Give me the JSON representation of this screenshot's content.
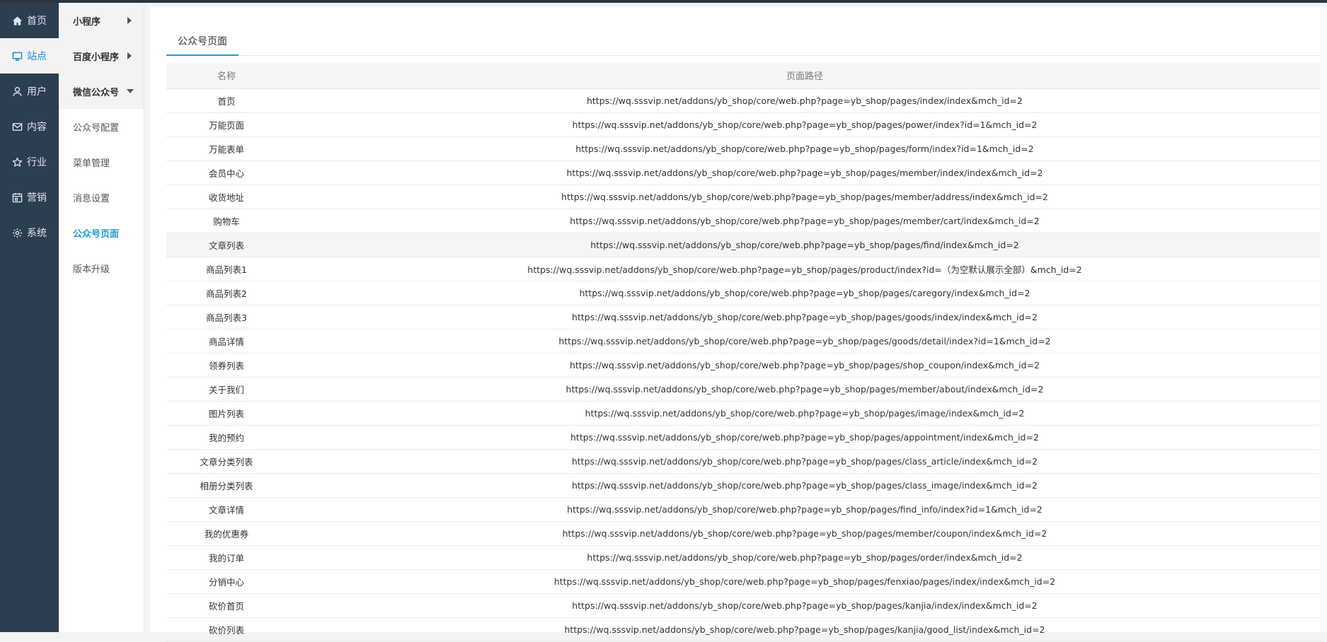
{
  "nav_primary": [
    {
      "label": "首页",
      "icon": "home-icon"
    },
    {
      "label": "站点",
      "icon": "monitor-icon",
      "active": true
    },
    {
      "label": "用户",
      "icon": "user-icon"
    },
    {
      "label": "内容",
      "icon": "mail-icon"
    },
    {
      "label": "行业",
      "icon": "star-icon"
    },
    {
      "label": "营销",
      "icon": "calendar-icon"
    },
    {
      "label": "系统",
      "icon": "gear-icon"
    }
  ],
  "nav_secondary": [
    {
      "label": "小程序",
      "type": "group",
      "caret": "right"
    },
    {
      "label": "百度小程序",
      "type": "group",
      "caret": "right"
    },
    {
      "label": "微信公众号",
      "type": "group",
      "caret": "down"
    },
    {
      "label": "公众号配置"
    },
    {
      "label": "菜单管理"
    },
    {
      "label": "消息设置"
    },
    {
      "label": "公众号页面",
      "active": true
    },
    {
      "label": "版本升级"
    }
  ],
  "tab": {
    "label": "公众号页面"
  },
  "table": {
    "headers": [
      "名称",
      "页面路径"
    ],
    "rows": [
      [
        "首页",
        "https://wq.sssvip.net/addons/yb_shop/core/web.php?page=yb_shop/pages/index/index&mch_id=2"
      ],
      [
        "万能页面",
        "https://wq.sssvip.net/addons/yb_shop/core/web.php?page=yb_shop/pages/power/index?id=1&mch_id=2"
      ],
      [
        "万能表单",
        "https://wq.sssvip.net/addons/yb_shop/core/web.php?page=yb_shop/pages/form/index?id=1&mch_id=2"
      ],
      [
        "会员中心",
        "https://wq.sssvip.net/addons/yb_shop/core/web.php?page=yb_shop/pages/member/index/index&mch_id=2"
      ],
      [
        "收货地址",
        "https://wq.sssvip.net/addons/yb_shop/core/web.php?page=yb_shop/pages/member/address/index&mch_id=2"
      ],
      [
        "购物车",
        "https://wq.sssvip.net/addons/yb_shop/core/web.php?page=yb_shop/pages/member/cart/index&mch_id=2"
      ],
      [
        "文章列表",
        "https://wq.sssvip.net/addons/yb_shop/core/web.php?page=yb_shop/pages/find/index&mch_id=2"
      ],
      [
        "商品列表1",
        "https://wq.sssvip.net/addons/yb_shop/core/web.php?page=yb_shop/pages/product/index?id=（为空默认展示全部）&mch_id=2"
      ],
      [
        "商品列表2",
        "https://wq.sssvip.net/addons/yb_shop/core/web.php?page=yb_shop/pages/caregory/index&mch_id=2"
      ],
      [
        "商品列表3",
        "https://wq.sssvip.net/addons/yb_shop/core/web.php?page=yb_shop/pages/goods/index/index&mch_id=2"
      ],
      [
        "商品详情",
        "https://wq.sssvip.net/addons/yb_shop/core/web.php?page=yb_shop/pages/goods/detail/index?id=1&mch_id=2"
      ],
      [
        "领券列表",
        "https://wq.sssvip.net/addons/yb_shop/core/web.php?page=yb_shop/pages/shop_coupon/index&mch_id=2"
      ],
      [
        "关于我们",
        "https://wq.sssvip.net/addons/yb_shop/core/web.php?page=yb_shop/pages/member/about/index&mch_id=2"
      ],
      [
        "图片列表",
        "https://wq.sssvip.net/addons/yb_shop/core/web.php?page=yb_shop/pages/image/index&mch_id=2"
      ],
      [
        "我的预约",
        "https://wq.sssvip.net/addons/yb_shop/core/web.php?page=yb_shop/pages/appointment/index&mch_id=2"
      ],
      [
        "文章分类列表",
        "https://wq.sssvip.net/addons/yb_shop/core/web.php?page=yb_shop/pages/class_article/index&mch_id=2"
      ],
      [
        "相册分类列表",
        "https://wq.sssvip.net/addons/yb_shop/core/web.php?page=yb_shop/pages/class_image/index&mch_id=2"
      ],
      [
        "文章详情",
        "https://wq.sssvip.net/addons/yb_shop/core/web.php?page=yb_shop/pages/find_info/index?id=1&mch_id=2"
      ],
      [
        "我的优惠券",
        "https://wq.sssvip.net/addons/yb_shop/core/web.php?page=yb_shop/pages/member/coupon/index&mch_id=2"
      ],
      [
        "我的订单",
        "https://wq.sssvip.net/addons/yb_shop/core/web.php?page=yb_shop/pages/order/index&mch_id=2"
      ],
      [
        "分销中心",
        "https://wq.sssvip.net/addons/yb_shop/core/web.php?page=yb_shop/pages/fenxiao/pages/index/index&mch_id=2"
      ],
      [
        "砍价首页",
        "https://wq.sssvip.net/addons/yb_shop/core/web.php?page=yb_shop/pages/kanjia/index/index&mch_id=2"
      ],
      [
        "砍价列表",
        "https://wq.sssvip.net/addons/yb_shop/core/web.php?page=yb_shop/pages/kanjia/good_list/index&mch_id=2"
      ]
    ]
  },
  "colors": {
    "sidebar_bg": "#2c3e50",
    "accent": "#1e9bd8",
    "active_nav_text": "#0c8fd6"
  }
}
